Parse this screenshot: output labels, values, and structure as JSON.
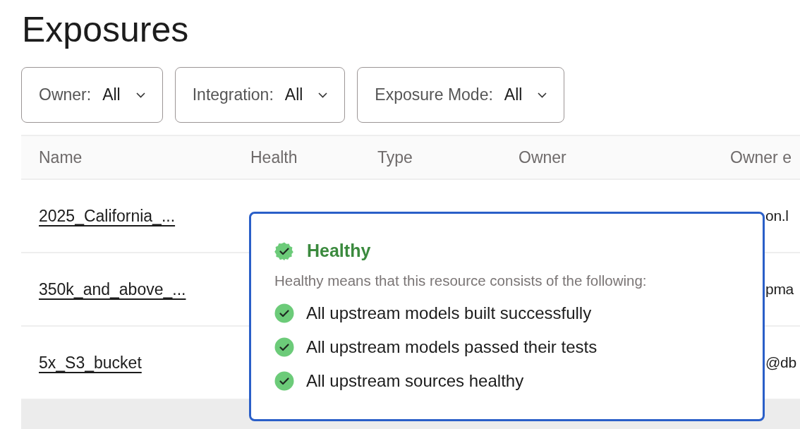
{
  "page": {
    "title": "Exposures"
  },
  "filters": [
    {
      "label": "Owner:",
      "value": "All"
    },
    {
      "label": "Integration:",
      "value": "All"
    },
    {
      "label": "Exposure Mode:",
      "value": "All"
    }
  ],
  "table": {
    "columns": [
      "Name",
      "Health",
      "Type",
      "Owner",
      "Owner e"
    ],
    "rows": [
      {
        "name": "2025_California_...",
        "owner_email": "on.l",
        "hovered": false
      },
      {
        "name": "350k_and_above_...",
        "owner_email": "pma",
        "hovered": false
      },
      {
        "name": "5x_S3_bucket",
        "owner_email": "@db",
        "hovered": false
      },
      {
        "hovered": true
      }
    ]
  },
  "popover": {
    "status": "Healthy",
    "description": "Healthy means that this resource consists of the following:",
    "items": [
      "All upstream models built successfully",
      "All upstream models passed their tests",
      "All upstream sources healthy"
    ]
  }
}
